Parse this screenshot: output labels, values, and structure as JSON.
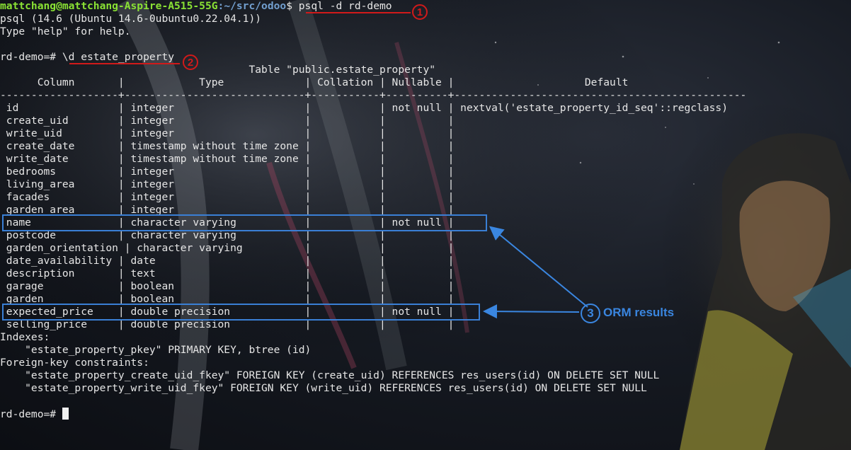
{
  "prompt": {
    "user_host": "mattchang@mattchang-Aspire-A515-55G",
    "path": ":~/src/odoo",
    "symbol": "$ ",
    "command": "psql -d rd-demo"
  },
  "lines": {
    "version": "psql (14.6 (Ubuntu 14.6-0ubuntu0.22.04.1))",
    "help": "Type \"help\" for help.",
    "db_prompt": "rd-demo=# ",
    "describe_cmd": "\\d estate_property",
    "table_title": "                                        Table \"public.estate_property\"",
    "header": "      Column       |            Type             | Collation | Nullable |                     Default",
    "separator": "-------------------+-----------------------------+-----------+----------+-----------------------------------------------",
    "indexes_label": "Indexes:",
    "index_1": "    \"estate_property_pkey\" PRIMARY KEY, btree (id)",
    "fk_label": "Foreign-key constraints:",
    "fk_1": "    \"estate_property_create_uid_fkey\" FOREIGN KEY (create_uid) REFERENCES res_users(id) ON DELETE SET NULL",
    "fk_2": "    \"estate_property_write_uid_fkey\" FOREIGN KEY (write_uid) REFERENCES res_users(id) ON DELETE SET NULL",
    "final_prompt": "rd-demo=# "
  },
  "rows": [
    " id                | integer                     |           | not null | nextval('estate_property_id_seq'::regclass)",
    " create_uid        | integer                     |           |          |",
    " write_uid         | integer                     |           |          |",
    " create_date       | timestamp without time zone |           |          |",
    " write_date        | timestamp without time zone |           |          |",
    " bedrooms          | integer                     |           |          |",
    " living_area       | integer                     |           |          |",
    " facades           | integer                     |           |          |",
    " garden_area       | integer                     |           |          |",
    " name              | character varying           |           | not null |",
    " postcode          | character varying           |           |          |",
    " garden_orientation | character varying          |           |          |",
    " date_availability | date                        |           |          |",
    " description       | text                        |           |          |",
    " garage            | boolean                     |           |          |",
    " garden            | boolean                     |           |          |",
    " expected_price    | double precision            |           | not null |",
    " selling_price     | double precision            |           |          |"
  ],
  "annotations": {
    "step1": "1",
    "step2": "2",
    "step3": "3",
    "orm_label": "ORM results"
  },
  "colors": {
    "red_annotation": "#d11a1a",
    "blue_annotation": "#3a86e0",
    "prompt_green": "#8ae234",
    "prompt_blue": "#729fcf"
  }
}
